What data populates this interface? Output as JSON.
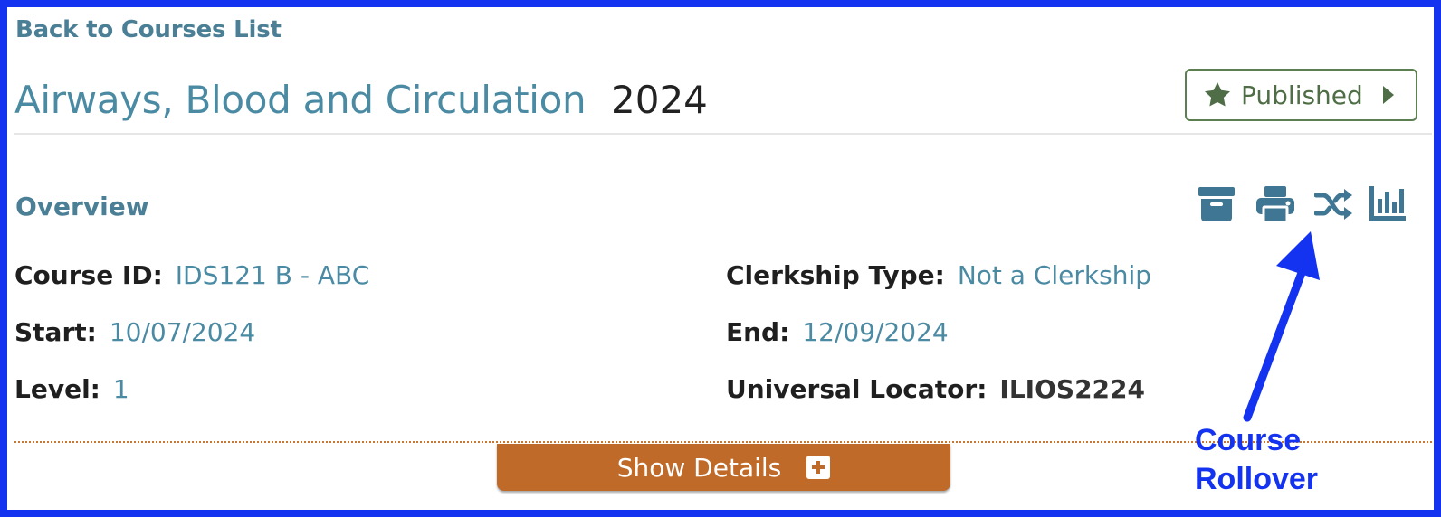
{
  "nav": {
    "back_label": "Back to Courses List"
  },
  "course": {
    "title": "Airways, Blood and Circulation",
    "year": "2024"
  },
  "publish": {
    "label": "Published",
    "icon": "star-icon",
    "caret_icon": "caret-right-icon"
  },
  "overview": {
    "heading": "Overview",
    "actions": [
      {
        "name": "archive-icon"
      },
      {
        "name": "print-icon"
      },
      {
        "name": "rollover-shuffle-icon"
      },
      {
        "name": "report-chart-icon"
      }
    ],
    "fields": {
      "course_id": {
        "label": "Course ID:",
        "value": "IDS121 B - ABC"
      },
      "start": {
        "label": "Start:",
        "value": "10/07/2024"
      },
      "level": {
        "label": "Level:",
        "value": "1"
      },
      "clerkship_type": {
        "label": "Clerkship Type:",
        "value": "Not a Clerkship"
      },
      "end": {
        "label": "End:",
        "value": "12/09/2024"
      },
      "universal_locator": {
        "label": "Universal Locator:",
        "value": "ILIOS2224"
      }
    }
  },
  "details_button": {
    "label": "Show Details"
  },
  "annotation": {
    "line1": "Course",
    "line2": "Rollover"
  },
  "colors": {
    "frame": "#1433f0",
    "link": "#4a8aa3",
    "published": "#4f6e47",
    "show_details": "#bf6a28",
    "icons": "#3f7693"
  }
}
